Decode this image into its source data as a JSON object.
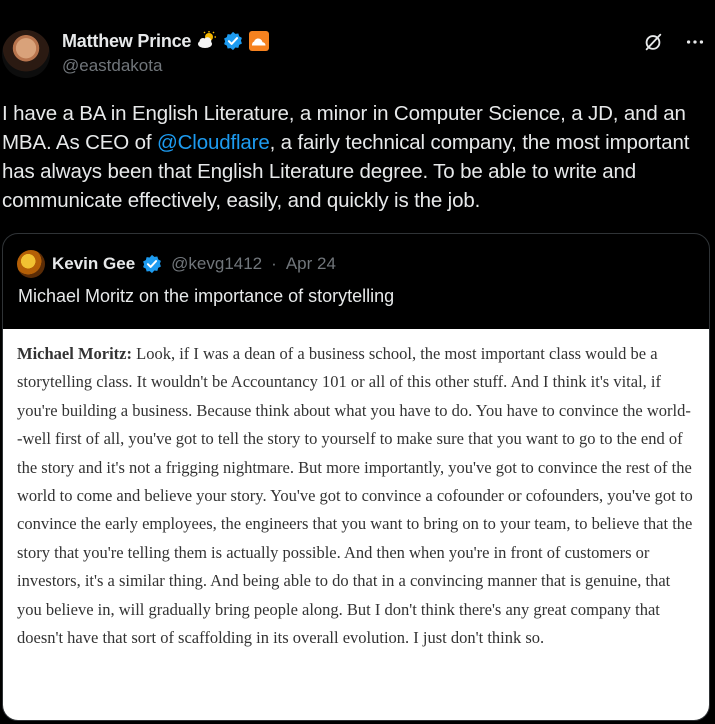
{
  "author": {
    "display_name": "Matthew Prince",
    "handle": "@eastdakota",
    "badges": [
      "weather-partly-cloudy-icon",
      "verified-badge-icon",
      "cloudflare-logo-icon"
    ]
  },
  "actions": {
    "grok_icon": "grok-icon",
    "more_icon": "more-options-icon"
  },
  "post": {
    "text_before_mention": "I have a BA in English Literature, a minor in Computer Science, a JD, and an MBA. As CEO of ",
    "mention": "@Cloudflare",
    "text_after_mention": ", a fairly technical company, the most important has always been that English Literature degree. To be able to write and communicate effectively, easily, and quickly is the job."
  },
  "quote": {
    "display_name": "Kevin Gee",
    "handle": "@kevg1412",
    "separator": "·",
    "date": "Apr 24",
    "text": "Michael Moritz on the importance of storytelling",
    "media": {
      "speaker": "Michael Moritz:",
      "body": " Look, if I was a dean of a business school, the most important class would be a storytelling class. It wouldn't be Accountancy 101 or all of this other stuff. And I think it's vital, if you're building a business. Because think about what you have to do. You have to convince the world--well first of all, you've got to tell the story to yourself to make sure that you want to go to the end of the story and it's not a frigging nightmare. But more importantly, you've got to convince the rest of the world to come and believe your story. You've got to convince a cofounder or cofounders, you've got to convince the early employees, the engineers that you want to bring on to your team, to believe that the story that you're telling them is actually possible. And then when you're in front of customers or investors, it's a similar thing. And being able to do that in a convincing manner that is genuine, that you believe in, will gradually bring people along. But I don't think there's any great company that doesn't have that sort of scaffolding in its overall evolution. I just don't think so."
    }
  },
  "colors": {
    "background": "#000000",
    "text": "#e7e9ea",
    "secondary_text": "#71767b",
    "link": "#1d9bf0",
    "verified": "#1d9bf0",
    "border": "#2f3336"
  }
}
